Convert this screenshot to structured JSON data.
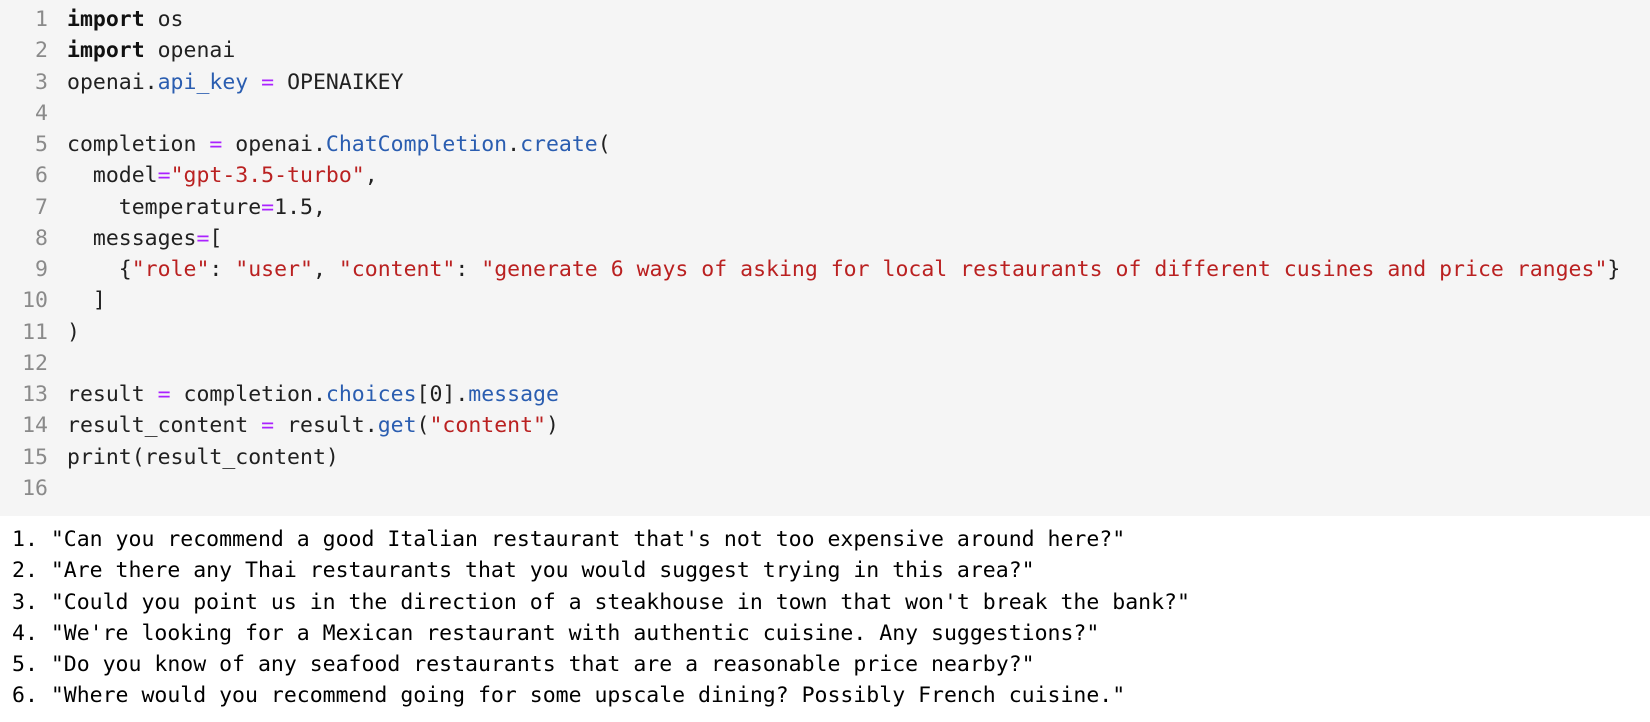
{
  "code_cell": {
    "lines": [
      {
        "n": "1",
        "tokens": [
          {
            "t": "import",
            "c": "k"
          },
          {
            "t": " os",
            "c": ""
          }
        ]
      },
      {
        "n": "2",
        "tokens": [
          {
            "t": "import",
            "c": "k"
          },
          {
            "t": " openai",
            "c": ""
          }
        ]
      },
      {
        "n": "3",
        "tokens": [
          {
            "t": "openai.",
            "c": ""
          },
          {
            "t": "api_key",
            "c": "a"
          },
          {
            "t": " ",
            "c": ""
          },
          {
            "t": "=",
            "c": "o"
          },
          {
            "t": " OPENAIKEY",
            "c": ""
          }
        ]
      },
      {
        "n": "4",
        "tokens": []
      },
      {
        "n": "5",
        "tokens": [
          {
            "t": "completion ",
            "c": ""
          },
          {
            "t": "=",
            "c": "o"
          },
          {
            "t": " openai.",
            "c": ""
          },
          {
            "t": "ChatCompletion",
            "c": "a"
          },
          {
            "t": ".",
            "c": ""
          },
          {
            "t": "create",
            "c": "a"
          },
          {
            "t": "(",
            "c": ""
          }
        ]
      },
      {
        "n": "6",
        "tokens": [
          {
            "t": "  model",
            "c": ""
          },
          {
            "t": "=",
            "c": "o"
          },
          {
            "t": "\"gpt-3.5-turbo\"",
            "c": "s"
          },
          {
            "t": ",",
            "c": ""
          }
        ]
      },
      {
        "n": "7",
        "tokens": [
          {
            "t": "    temperature",
            "c": ""
          },
          {
            "t": "=",
            "c": "o"
          },
          {
            "t": "1.5,",
            "c": ""
          }
        ]
      },
      {
        "n": "8",
        "tokens": [
          {
            "t": "  messages",
            "c": ""
          },
          {
            "t": "=",
            "c": "o"
          },
          {
            "t": "[",
            "c": ""
          }
        ]
      },
      {
        "n": "9",
        "tokens": [
          {
            "t": "    {",
            "c": ""
          },
          {
            "t": "\"role\"",
            "c": "s"
          },
          {
            "t": ": ",
            "c": ""
          },
          {
            "t": "\"user\"",
            "c": "s"
          },
          {
            "t": ", ",
            "c": ""
          },
          {
            "t": "\"content\"",
            "c": "s"
          },
          {
            "t": ": ",
            "c": ""
          },
          {
            "t": "\"generate 6 ways of asking for local restaurants of different cusines and price ranges\"",
            "c": "s"
          },
          {
            "t": "}",
            "c": ""
          }
        ]
      },
      {
        "n": "10",
        "tokens": [
          {
            "t": "  ]",
            "c": ""
          }
        ]
      },
      {
        "n": "11",
        "tokens": [
          {
            "t": ")",
            "c": ""
          }
        ]
      },
      {
        "n": "12",
        "tokens": []
      },
      {
        "n": "13",
        "tokens": [
          {
            "t": "result ",
            "c": ""
          },
          {
            "t": "=",
            "c": "o"
          },
          {
            "t": " completion.",
            "c": ""
          },
          {
            "t": "choices",
            "c": "a"
          },
          {
            "t": "[0].",
            "c": ""
          },
          {
            "t": "message",
            "c": "a"
          }
        ]
      },
      {
        "n": "14",
        "tokens": [
          {
            "t": "result_content ",
            "c": ""
          },
          {
            "t": "=",
            "c": "o"
          },
          {
            "t": " result.",
            "c": ""
          },
          {
            "t": "get",
            "c": "a"
          },
          {
            "t": "(",
            "c": ""
          },
          {
            "t": "\"content\"",
            "c": "s"
          },
          {
            "t": ")",
            "c": ""
          }
        ]
      },
      {
        "n": "15",
        "tokens": [
          {
            "t": "print(result_content)",
            "c": ""
          }
        ]
      },
      {
        "n": "16",
        "tokens": []
      }
    ]
  },
  "output": {
    "lines": [
      "1. \"Can you recommend a good Italian restaurant that's not too expensive around here?\"",
      "2. \"Are there any Thai restaurants that you would suggest trying in this area?\"",
      "3. \"Could you point us in the direction of a steakhouse in town that won't break the bank?\"",
      "4. \"We're looking for a Mexican restaurant with authentic cuisine. Any suggestions?\"",
      "5. \"Do you know of any seafood restaurants that are a reasonable price nearby?\"",
      "6. \"Where would you recommend going for some upscale dining? Possibly French cuisine.\""
    ]
  }
}
